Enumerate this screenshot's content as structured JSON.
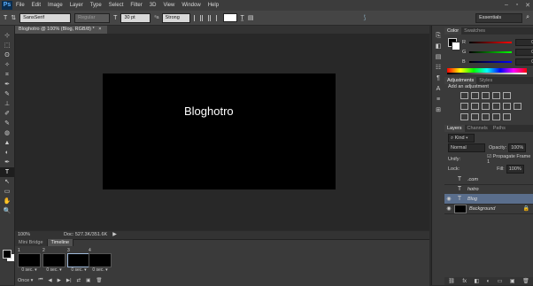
{
  "menu": {
    "logo": "Ps",
    "items": [
      "File",
      "Edit",
      "Image",
      "Layer",
      "Type",
      "Select",
      "Filter",
      "3D",
      "View",
      "Window",
      "Help"
    ],
    "window_controls": [
      "–",
      "▫",
      "✕"
    ]
  },
  "options": {
    "tool_icon": "T",
    "orient_icon": "⇅",
    "font_family": "SansSerif",
    "font_style": "Regular",
    "size_icon": "T",
    "font_size": "30 pt",
    "aa_label": "ªa",
    "anti_alias": "Strong",
    "warp_icon": "T̰",
    "panel_icon": "▤",
    "workspace": "Essentials",
    "search_icon": "⌕"
  },
  "document": {
    "tab_title": "Bloghotro @ 100% (Blog, RGB/8) *",
    "tab_close": "×",
    "canvas_text": "Bloghotro",
    "zoom": "100%",
    "doc_size": "Doc: 527.3K/351.6K",
    "status_arrow": "▶"
  },
  "tools": [
    "⊹",
    "⬚",
    "ʘ",
    "✧",
    "⌗",
    "✒",
    "✎",
    "⊥",
    "✐",
    "✎",
    "◍",
    "▲",
    "◐",
    "✒",
    "T",
    "↖",
    "▭",
    "✋",
    "🔍"
  ],
  "timeline": {
    "tabs": [
      "Mini Bridge",
      "Timeline"
    ],
    "frames": [
      {
        "num": "1",
        "dur": "0 sec. ▾",
        "selected": false
      },
      {
        "num": "2",
        "dur": "0 sec. ▾",
        "selected": false
      },
      {
        "num": "3",
        "dur": "0 sec. ▾",
        "selected": true
      },
      {
        "num": "4",
        "dur": "0 sec. ▾",
        "selected": false
      }
    ],
    "loop": "Once ▾",
    "controls": [
      "⏮",
      "◀",
      "▶",
      "▶|",
      "⇄",
      "▣",
      "🗑"
    ]
  },
  "mini_panels": [
    "⎘",
    "◧",
    "▤",
    "☷",
    "¶",
    "A",
    "≡",
    "⊞"
  ],
  "color_panel": {
    "tabs": [
      "Color",
      "Swatches"
    ],
    "sliders": [
      {
        "label": "R",
        "value": "0"
      },
      {
        "label": "G",
        "value": "0"
      },
      {
        "label": "B",
        "value": "0"
      }
    ]
  },
  "adjustments_panel": {
    "tabs": [
      "Adjustments",
      "Styles"
    ],
    "title": "Add an adjustment"
  },
  "layers_panel": {
    "tabs": [
      "Layers",
      "Channels",
      "Paths"
    ],
    "kind": "⌕ Kind ▾",
    "blend_mode": "Normal",
    "opacity_label": "Opacity:",
    "opacity": "100%",
    "unify_label": "Unify:",
    "propagate_label": "☑ Propagate Frame 1",
    "lock_label": "Lock:",
    "fill_label": "Fill:",
    "fill": "100%",
    "layers": [
      {
        "name": ".com",
        "type": "text",
        "visible": false,
        "selected": false
      },
      {
        "name": "hotro",
        "type": "text",
        "visible": false,
        "selected": false
      },
      {
        "name": "Blog",
        "type": "text",
        "visible": true,
        "selected": true
      },
      {
        "name": "Background",
        "type": "image",
        "visible": true,
        "selected": false
      }
    ],
    "footer_icons": [
      "⛓",
      "fx",
      "◧",
      "◐",
      "▭",
      "▣",
      "🗑"
    ]
  },
  "colors": {
    "canvas_bg": "#000000",
    "selected_layer": "#5a6e8c",
    "workspace_bg": "#282828"
  }
}
